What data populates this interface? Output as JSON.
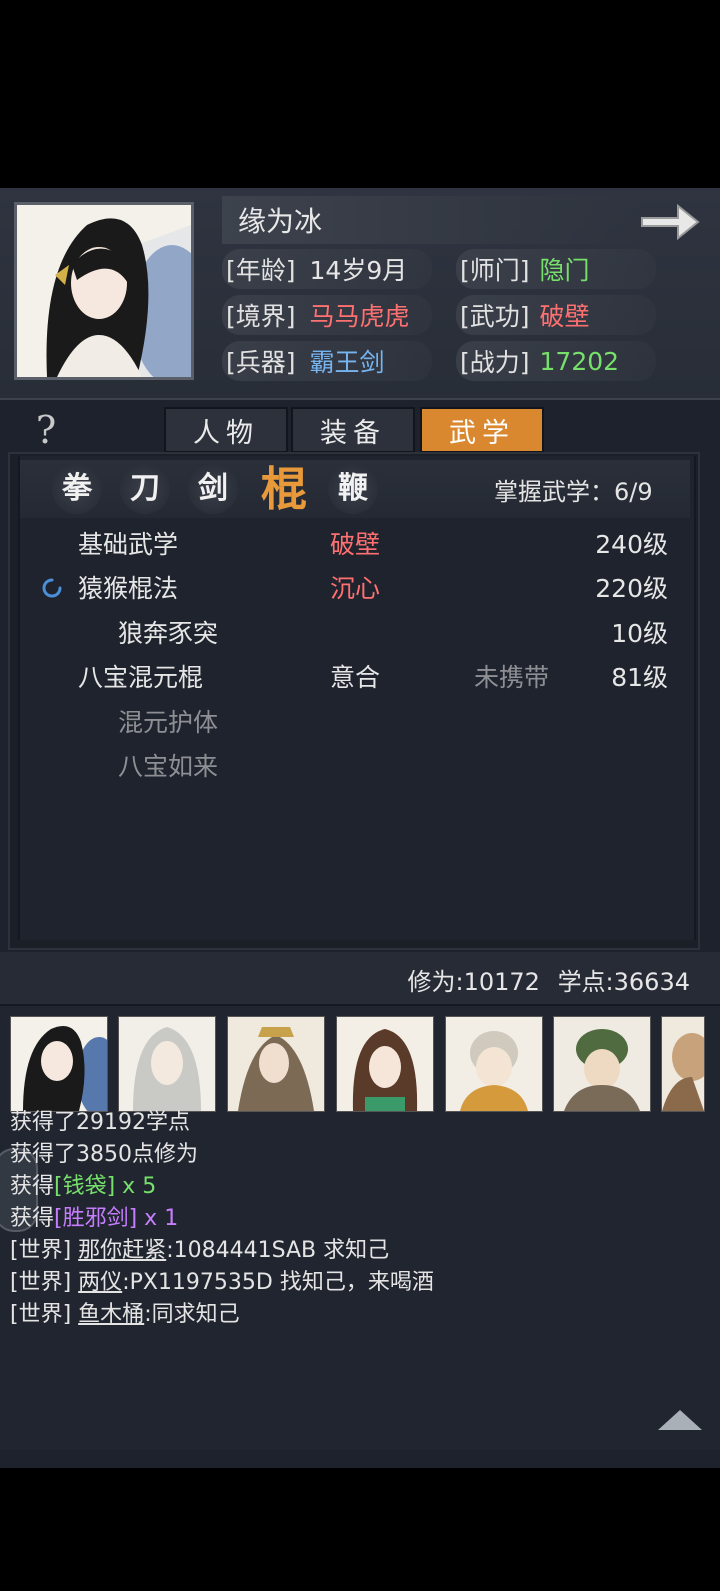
{
  "character": {
    "name": "缘为冰",
    "age_label": "[年龄]",
    "age": "14岁9月",
    "school_label": "[师门]",
    "school": "隐门",
    "realm_label": "[境界]",
    "realm": "马马虎虎",
    "martial_label": "[武功]",
    "martial": "破壁",
    "weapon_label": "[兵器]",
    "weapon": "霸王剑",
    "power_label": "[战力]",
    "power": "17202"
  },
  "tabs": [
    {
      "label": "人物"
    },
    {
      "label": "装备"
    },
    {
      "label": "武学"
    }
  ],
  "help_icon": "?",
  "categories": [
    "拳",
    "刀",
    "剑",
    "棍",
    "鞭"
  ],
  "mastery": "掌握武学：6/9",
  "skills": [
    {
      "name": "基础武学",
      "state": "破壁",
      "carry": "",
      "level": "240级"
    },
    {
      "name": "猿猴棍法",
      "state": "沉心",
      "carry": "",
      "level": "220级"
    },
    {
      "name": "狼奔豕突",
      "state": "",
      "carry": "",
      "level": "10级"
    },
    {
      "name": "八宝混元棍",
      "state": "意合",
      "carry": "未携带",
      "level": "81级"
    },
    {
      "name": "混元护体",
      "state": "",
      "carry": "",
      "level": ""
    },
    {
      "name": "八宝如来",
      "state": "",
      "carry": "",
      "level": ""
    }
  ],
  "stats": {
    "cultivation": "修为:10172",
    "points": "学点:36634"
  },
  "chat": {
    "m1": "获得了29192学点",
    "m2": "获得了3850点修为",
    "m3_prefix": "获得",
    "m3_item": "[钱袋]",
    "m3_count": " x 5",
    "m4_prefix": "获得",
    "m4_item": "[胜邪剑]",
    "m4_count": " x 1",
    "world": "[世界]",
    "w1_user": "那你赶紧",
    "w1_text": ":1084441SAB 求知己",
    "w2_user": "两仪",
    "w2_text": ":PX1197535D 找知己，来喝酒",
    "w3_user": "鱼木桶",
    "w3_text": ":同求知己"
  },
  "colors": {
    "accent": "#d9882f",
    "green": "#77e06a",
    "red": "#ff7070",
    "blue": "#76b4f0",
    "purple": "#c77dff"
  }
}
